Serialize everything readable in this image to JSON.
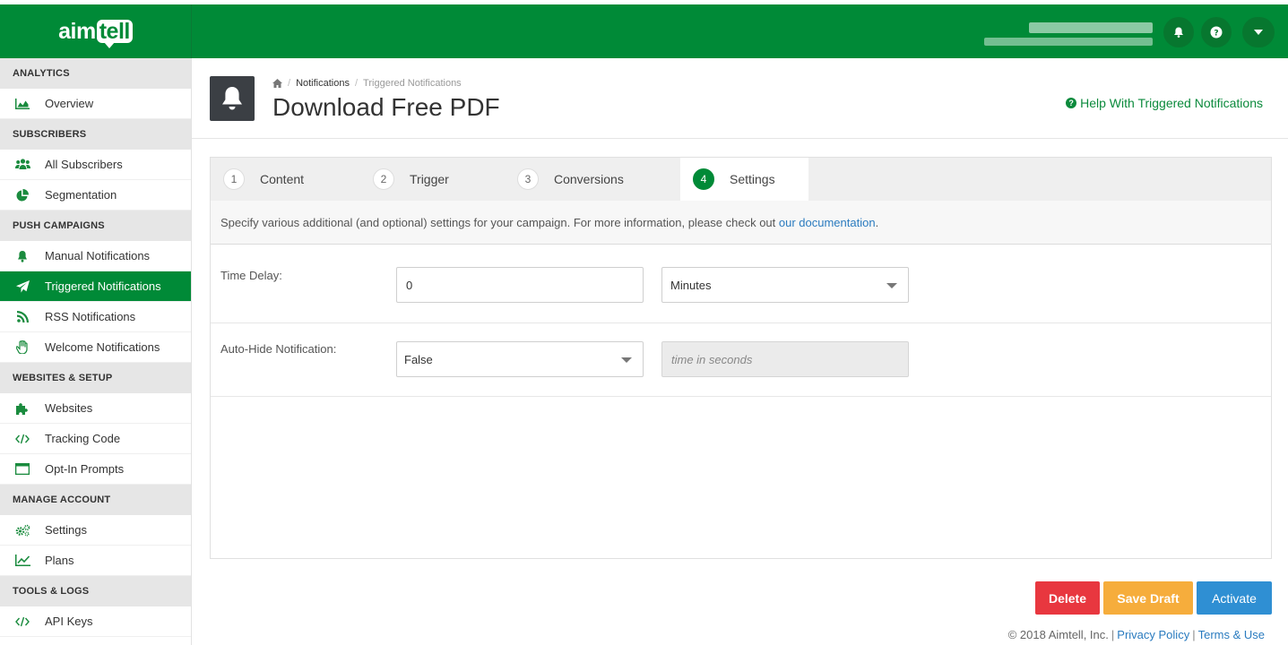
{
  "brand": {
    "logo_left": "aim",
    "logo_right": "tell"
  },
  "sidebar": {
    "sections": [
      {
        "title": "ANALYTICS",
        "items": [
          {
            "label": "Overview",
            "icon": "area-chart-icon"
          }
        ]
      },
      {
        "title": "SUBSCRIBERS",
        "items": [
          {
            "label": "All Subscribers",
            "icon": "users-icon"
          },
          {
            "label": "Segmentation",
            "icon": "pie-chart-icon"
          }
        ]
      },
      {
        "title": "PUSH CAMPAIGNS",
        "items": [
          {
            "label": "Manual Notifications",
            "icon": "bell-icon"
          },
          {
            "label": "Triggered Notifications",
            "icon": "paper-plane-icon"
          },
          {
            "label": "RSS Notifications",
            "icon": "rss-icon"
          },
          {
            "label": "Welcome Notifications",
            "icon": "hand-wave-icon"
          }
        ]
      },
      {
        "title": "WEBSITES & SETUP",
        "items": [
          {
            "label": "Websites",
            "icon": "puzzle-icon"
          },
          {
            "label": "Tracking Code",
            "icon": "code-icon"
          },
          {
            "label": "Opt-In Prompts",
            "icon": "window-icon"
          }
        ]
      },
      {
        "title": "MANAGE ACCOUNT",
        "items": [
          {
            "label": "Settings",
            "icon": "gears-icon"
          },
          {
            "label": "Plans",
            "icon": "line-chart-icon"
          }
        ]
      },
      {
        "title": "TOOLS & LOGS",
        "items": [
          {
            "label": "API Keys",
            "icon": "code-icon"
          }
        ]
      }
    ],
    "active": "Triggered Notifications"
  },
  "breadcrumb": {
    "parent": "Notifications",
    "current": "Triggered Notifications"
  },
  "page": {
    "title": "Download Free PDF",
    "help": "Help With Triggered Notifications"
  },
  "tabs": [
    {
      "num": "1",
      "label": "Content"
    },
    {
      "num": "2",
      "label": "Trigger"
    },
    {
      "num": "3",
      "label": "Conversions"
    },
    {
      "num": "4",
      "label": "Settings",
      "active": true
    }
  ],
  "intro": {
    "text": "Specify various additional (and optional) settings for your campaign. For more information, please check out ",
    "link": "our documentation",
    "end": "."
  },
  "form": {
    "time_delay_label": "Time Delay:",
    "time_delay_value": "0",
    "time_delay_unit": "Minutes",
    "autohide_label": "Auto-Hide Notification:",
    "autohide_value": "False",
    "autohide_seconds_placeholder": "time in seconds"
  },
  "buttons": {
    "delete": "Delete",
    "draft": "Save Draft",
    "activate": "Activate"
  },
  "footer": {
    "copyright": "© 2018 Aimtell, Inc.",
    "privacy": "Privacy Policy",
    "terms": "Terms & Use"
  },
  "colors": {
    "brand": "#008a37",
    "delete": "#e8373f",
    "draft": "#f6ad3c",
    "activate": "#2f8fd3"
  }
}
